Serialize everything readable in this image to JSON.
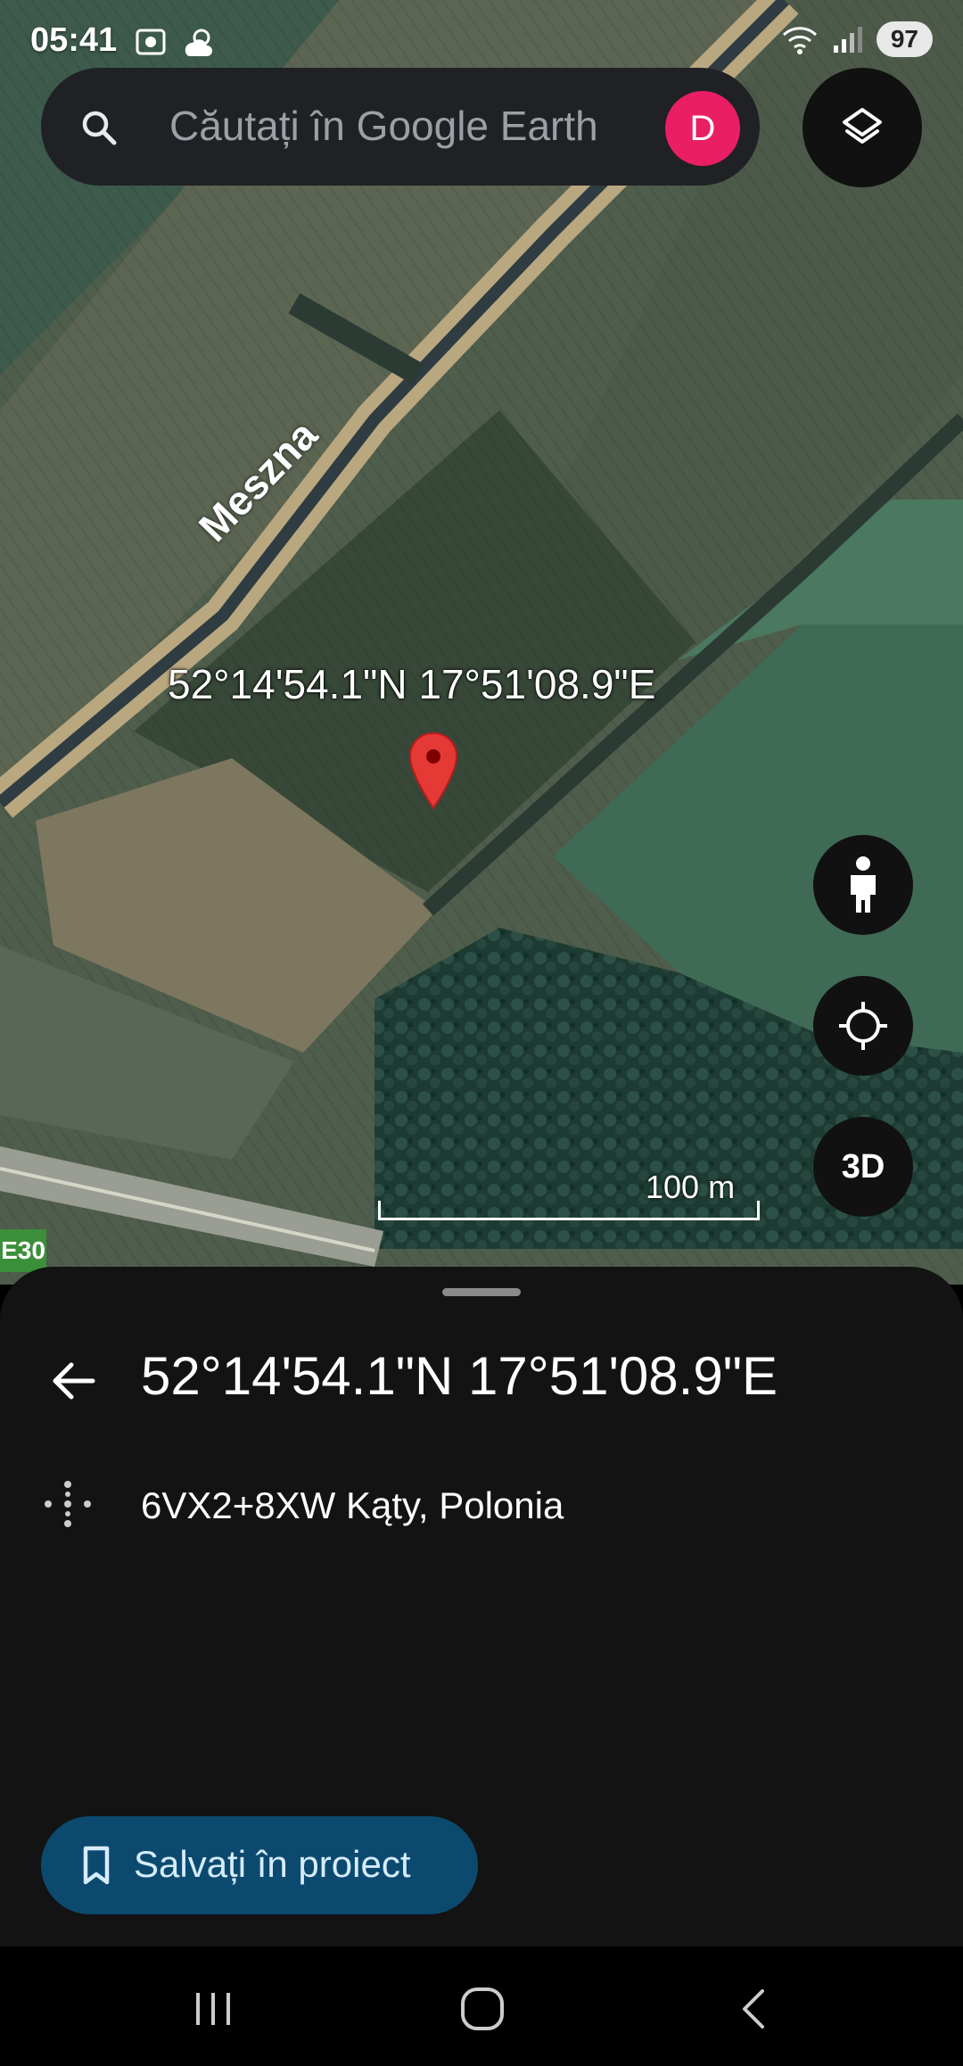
{
  "status_bar": {
    "time": "05:41",
    "battery": "97",
    "icons": [
      "screenshot-icon",
      "weather-icon",
      "wifi-icon",
      "signal-icon"
    ]
  },
  "search": {
    "placeholder": "Căutați în Google Earth",
    "avatar_letter": "D",
    "avatar_color": "#e91e63"
  },
  "map": {
    "road_label": "Meszna",
    "pin_label": "52°14'54.1\"N 17°51'08.9\"E",
    "scale_label": "100 m",
    "route_badge": "E30",
    "fab_3d_label": "3D"
  },
  "sheet": {
    "title": "52°14'54.1\"N 17°51'08.9\"E",
    "plus_code": "6VX2+8XW Kąty, Polonia",
    "save_button": "Salvați în proiect"
  },
  "colors": {
    "sheet_bg": "#131313",
    "save_button_bg": "#0b4a6e",
    "pin": "#e53935"
  }
}
